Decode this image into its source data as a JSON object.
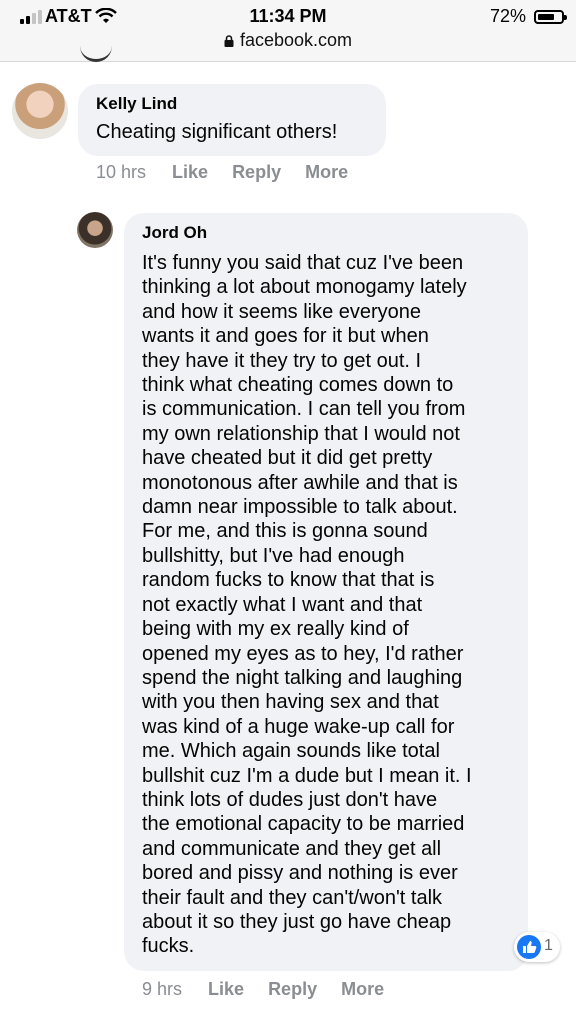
{
  "status_bar": {
    "carrier": "AT&T",
    "time": "11:34 PM",
    "battery": "72%"
  },
  "browser": {
    "url": "facebook.com"
  },
  "comments": [
    {
      "author": "Kelly Lind",
      "text": "Cheating significant others!",
      "time": "10 hrs",
      "actions": [
        "Like",
        "Reply",
        "More"
      ]
    },
    {
      "author": "Jord Oh",
      "lines": [
        "It's funny you said that cuz I've been",
        "thinking a lot about monogamy lately",
        "and how it seems like everyone",
        "wants it and goes for it but when",
        "they have it they try to get out. I",
        "think what cheating comes down to",
        "is communication. I can tell you from",
        "my own relationship that I would not",
        "have cheated but it did get pretty",
        "monotonous after awhile and that is",
        "damn near impossible to talk about.",
        "For me, and this is gonna sound",
        "bullshitty, but I've had enough",
        "random fucks to know that that is",
        "not exactly what I want and that",
        "being with my ex really kind of",
        "opened my eyes as to hey, I'd rather",
        "spend the night talking and laughing",
        "with you then having sex and that",
        "was kind of a huge wake-up call for",
        "me. Which again sounds like total",
        "bullshit cuz I'm a dude but I mean it. I",
        "think lots of dudes just don't have",
        "the emotional capacity to be married",
        "and communicate and they get all",
        "bored and pissy and nothing is ever",
        "their fault and they can't/won't talk",
        "about it so they just go have cheap",
        "fucks."
      ],
      "reaction": {
        "icon": "like-icon",
        "count": "1"
      },
      "time": "9 hrs",
      "actions": [
        "Like",
        "Reply",
        "More"
      ]
    }
  ],
  "colors": {
    "bubble": "#f0f2f5",
    "meta": "#8a8d91",
    "like": "#1877f2"
  }
}
